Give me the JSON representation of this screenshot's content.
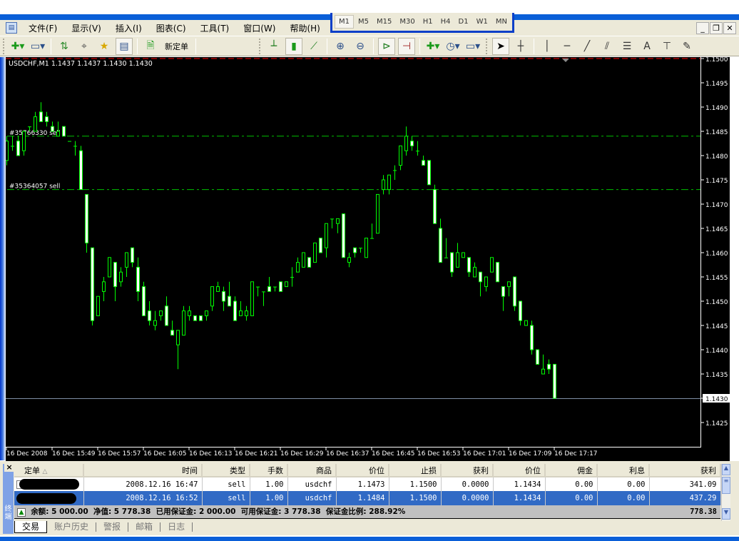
{
  "menu": [
    "文件(F)",
    "显示(V)",
    "插入(I)",
    "图表(C)",
    "工具(T)",
    "窗口(W)",
    "帮助(H)"
  ],
  "toolbar": {
    "new_order": "新定单"
  },
  "timeframes": [
    "M1",
    "M5",
    "M15",
    "M30",
    "H1",
    "H4",
    "D1",
    "W1",
    "MN"
  ],
  "active_timeframe": "M1",
  "chart_header": "USDCHF,M1  1.1437 1.1437 1.1430 1.1430",
  "colors": {
    "bull_fill": "#000000",
    "bear_fill": "#ffffff",
    "candle_outline": "#00ff00",
    "order_line": "#00c000",
    "stop_line": "#ff0000",
    "price_line": "#7f8fa6",
    "selected_row": "#316ac5"
  },
  "chart_data": {
    "type": "candlestick",
    "symbol": "USDCHF",
    "timeframe": "M1",
    "ylim": [
      1.142,
      1.1502
    ],
    "price_ticks": [
      "1.1500",
      "1.1495",
      "1.1490",
      "1.1485",
      "1.1480",
      "1.1475",
      "1.1470",
      "1.1465",
      "1.1460",
      "1.1455",
      "1.1450",
      "1.1445",
      "1.1440",
      "1.1435",
      "1.1430",
      "1.1425"
    ],
    "current_price": "1.1430",
    "time_labels": [
      "16 Dec 2008",
      "16 Dec 15:49",
      "16 Dec 15:57",
      "16 Dec 16:05",
      "16 Dec 16:13",
      "16 Dec 16:21",
      "16 Dec 16:29",
      "16 Dec 16:37",
      "16 Dec 16:45",
      "16 Dec 16:53",
      "16 Dec 17:01",
      "16 Dec 17:09",
      "16 Dec 17:17"
    ],
    "order_lines": [
      {
        "label": "#35766330 sell",
        "price": 1.1484
      },
      {
        "label": "#35364057 sell",
        "price": 1.1473
      }
    ],
    "stop_loss": 1.15,
    "ohlc": [
      [
        1.1479,
        1.1484,
        1.1478,
        1.1483
      ],
      [
        1.1482,
        1.1484,
        1.1481,
        1.1482
      ],
      [
        1.1483,
        1.1484,
        1.148,
        1.148
      ],
      [
        1.1481,
        1.1485,
        1.148,
        1.1485
      ],
      [
        1.1486,
        1.1486,
        1.1485,
        1.1486
      ],
      [
        1.1485,
        1.1489,
        1.1485,
        1.1488
      ],
      [
        1.1489,
        1.1491,
        1.1487,
        1.1487
      ],
      [
        1.1488,
        1.1489,
        1.1486,
        1.1487
      ],
      [
        1.1486,
        1.1487,
        1.1485,
        1.1485
      ],
      [
        1.1484,
        1.1487,
        1.1484,
        1.1485
      ],
      [
        1.1486,
        1.1486,
        1.1484,
        1.1484
      ],
      [
        1.1483,
        1.1483,
        1.1483,
        1.1483
      ],
      [
        1.1482,
        1.1483,
        1.148,
        1.1482
      ],
      [
        1.1481,
        1.1482,
        1.1473,
        1.1473
      ],
      [
        1.1472,
        1.1472,
        1.146,
        1.1462
      ],
      [
        1.1461,
        1.1461,
        1.1445,
        1.1446
      ],
      [
        1.1447,
        1.1451,
        1.1447,
        1.1451
      ],
      [
        1.1452,
        1.1455,
        1.145,
        1.1454
      ],
      [
        1.1455,
        1.1459,
        1.1455,
        1.1459
      ],
      [
        1.1458,
        1.1458,
        1.145,
        1.1453
      ],
      [
        1.1454,
        1.1457,
        1.1453,
        1.1456
      ],
      [
        1.1457,
        1.146,
        1.1455,
        1.146
      ],
      [
        1.1461,
        1.1461,
        1.1457,
        1.1458
      ],
      [
        1.1457,
        1.1459,
        1.145,
        1.1452
      ],
      [
        1.1453,
        1.1454,
        1.1447,
        1.1447
      ],
      [
        1.1448,
        1.145,
        1.1445,
        1.1446
      ],
      [
        1.1445,
        1.1448,
        1.1444,
        1.1446
      ],
      [
        1.1447,
        1.1448,
        1.1446,
        1.1448
      ],
      [
        1.1449,
        1.1451,
        1.1445,
        1.1445
      ],
      [
        1.1444,
        1.1446,
        1.1443,
        1.1443
      ],
      [
        1.1441,
        1.1444,
        1.1436,
        1.1444
      ],
      [
        1.1443,
        1.1449,
        1.1443,
        1.1448
      ],
      [
        1.1447,
        1.1449,
        1.1446,
        1.1448
      ],
      [
        1.1447,
        1.1447,
        1.1446,
        1.1446
      ],
      [
        1.1447,
        1.1447,
        1.1446,
        1.1446
      ],
      [
        1.1447,
        1.1448,
        1.1446,
        1.1448
      ],
      [
        1.1449,
        1.1453,
        1.1448,
        1.1453
      ],
      [
        1.1452,
        1.1454,
        1.1452,
        1.1453
      ],
      [
        1.1452,
        1.1453,
        1.1448,
        1.145
      ],
      [
        1.1451,
        1.1454,
        1.1449,
        1.1449
      ],
      [
        1.145,
        1.1451,
        1.1446,
        1.1446
      ],
      [
        1.1447,
        1.145,
        1.1447,
        1.1448
      ],
      [
        1.1447,
        1.1449,
        1.1446,
        1.1448
      ],
      [
        1.1447,
        1.1454,
        1.1447,
        1.1454
      ],
      [
        1.1453,
        1.1453,
        1.1451,
        1.1453
      ],
      [
        1.1452,
        1.1452,
        1.1449,
        1.1452
      ],
      [
        1.1453,
        1.1455,
        1.1452,
        1.1452
      ],
      [
        1.1453,
        1.1453,
        1.1452,
        1.1453
      ],
      [
        1.1454,
        1.1454,
        1.1452,
        1.1452
      ],
      [
        1.1453,
        1.1454,
        1.1453,
        1.1454
      ],
      [
        1.1455,
        1.1457,
        1.1453,
        1.1455
      ],
      [
        1.1456,
        1.1459,
        1.1456,
        1.1458
      ],
      [
        1.1457,
        1.146,
        1.1457,
        1.146
      ],
      [
        1.1459,
        1.1459,
        1.1457,
        1.1457
      ],
      [
        1.1458,
        1.1462,
        1.1458,
        1.1462
      ],
      [
        1.1463,
        1.1463,
        1.146,
        1.146
      ],
      [
        1.1461,
        1.1466,
        1.1459,
        1.1466
      ],
      [
        1.1467,
        1.1467,
        1.1465,
        1.1467
      ],
      [
        1.1466,
        1.1467,
        1.1464,
        1.1467
      ],
      [
        1.1468,
        1.1468,
        1.1459,
        1.1459
      ],
      [
        1.1458,
        1.146,
        1.1457,
        1.1459
      ],
      [
        1.1461,
        1.1461,
        1.1459,
        1.146
      ],
      [
        1.1461,
        1.1461,
        1.146,
        1.1461
      ],
      [
        1.1459,
        1.1463,
        1.1459,
        1.1463
      ],
      [
        1.1463,
        1.1466,
        1.1463,
        1.1463
      ],
      [
        1.1464,
        1.1472,
        1.1464,
        1.1472
      ],
      [
        1.1473,
        1.1476,
        1.1472,
        1.1475
      ],
      [
        1.1473,
        1.1476,
        1.1472,
        1.1476
      ],
      [
        1.1477,
        1.1478,
        1.1475,
        1.1477
      ],
      [
        1.1478,
        1.1482,
        1.1477,
        1.1482
      ],
      [
        1.1481,
        1.1486,
        1.148,
        1.1484
      ],
      [
        1.1483,
        1.1484,
        1.1481,
        1.1482
      ],
      [
        1.1481,
        1.1483,
        1.148,
        1.1481
      ],
      [
        1.1479,
        1.148,
        1.1478,
        1.1478
      ],
      [
        1.1479,
        1.1479,
        1.1474,
        1.1474
      ],
      [
        1.1473,
        1.1474,
        1.1466,
        1.1466
      ],
      [
        1.1465,
        1.1467,
        1.1458,
        1.1458
      ],
      [
        1.1459,
        1.1463,
        1.1459,
        1.1459
      ],
      [
        1.146,
        1.146,
        1.1455,
        1.1456
      ],
      [
        1.1457,
        1.1462,
        1.1457,
        1.146
      ],
      [
        1.1459,
        1.146,
        1.1459,
        1.146
      ],
      [
        1.1459,
        1.1459,
        1.1455,
        1.1456
      ],
      [
        1.1455,
        1.1458,
        1.1455,
        1.1457
      ],
      [
        1.1456,
        1.1456,
        1.1451,
        1.1454
      ],
      [
        1.1453,
        1.1455,
        1.1452,
        1.1455
      ],
      [
        1.1456,
        1.1459,
        1.1456,
        1.1459
      ],
      [
        1.1458,
        1.1458,
        1.1454,
        1.1454
      ],
      [
        1.1453,
        1.1453,
        1.1448,
        1.1451
      ],
      [
        1.1453,
        1.1454,
        1.1451,
        1.1454
      ],
      [
        1.1455,
        1.1455,
        1.1448,
        1.1449
      ],
      [
        1.145,
        1.145,
        1.1445,
        1.1446
      ],
      [
        1.1445,
        1.1446,
        1.1445,
        1.1446
      ],
      [
        1.1445,
        1.1446,
        1.1439,
        1.144
      ],
      [
        1.144,
        1.144,
        1.1437,
        1.1437
      ],
      [
        1.1435,
        1.1439,
        1.1435,
        1.1436
      ],
      [
        1.1437,
        1.1438,
        1.1435,
        1.1436
      ],
      [
        1.1437,
        1.1437,
        1.143,
        1.143
      ]
    ]
  },
  "terminal": {
    "side_label": "终端",
    "columns": [
      "定单",
      "时间",
      "类型",
      "手数",
      "商品",
      "价位",
      "止损",
      "获利",
      "价位",
      "佣金",
      "利息",
      "获利"
    ],
    "rows": [
      [
        "2008.12.16 16:47",
        "sell",
        "1.00",
        "usdchf",
        "1.1473",
        "1.1500",
        "0.0000",
        "1.1434",
        "0.00",
        "0.00",
        "341.09"
      ],
      [
        "2008.12.16 16:52",
        "sell",
        "1.00",
        "usdchf",
        "1.1484",
        "1.1500",
        "0.0000",
        "1.1434",
        "0.00",
        "0.00",
        "437.29"
      ]
    ],
    "summary": "余额: 5 000.00  净值: 5 778.38  已用保证金: 2 000.00  可用保证金: 3 778.38  保证金比例: 288.92%",
    "summary_total": "778.38",
    "tabs": [
      "交易",
      "账户历史",
      "警报",
      "邮箱",
      "日志"
    ]
  }
}
